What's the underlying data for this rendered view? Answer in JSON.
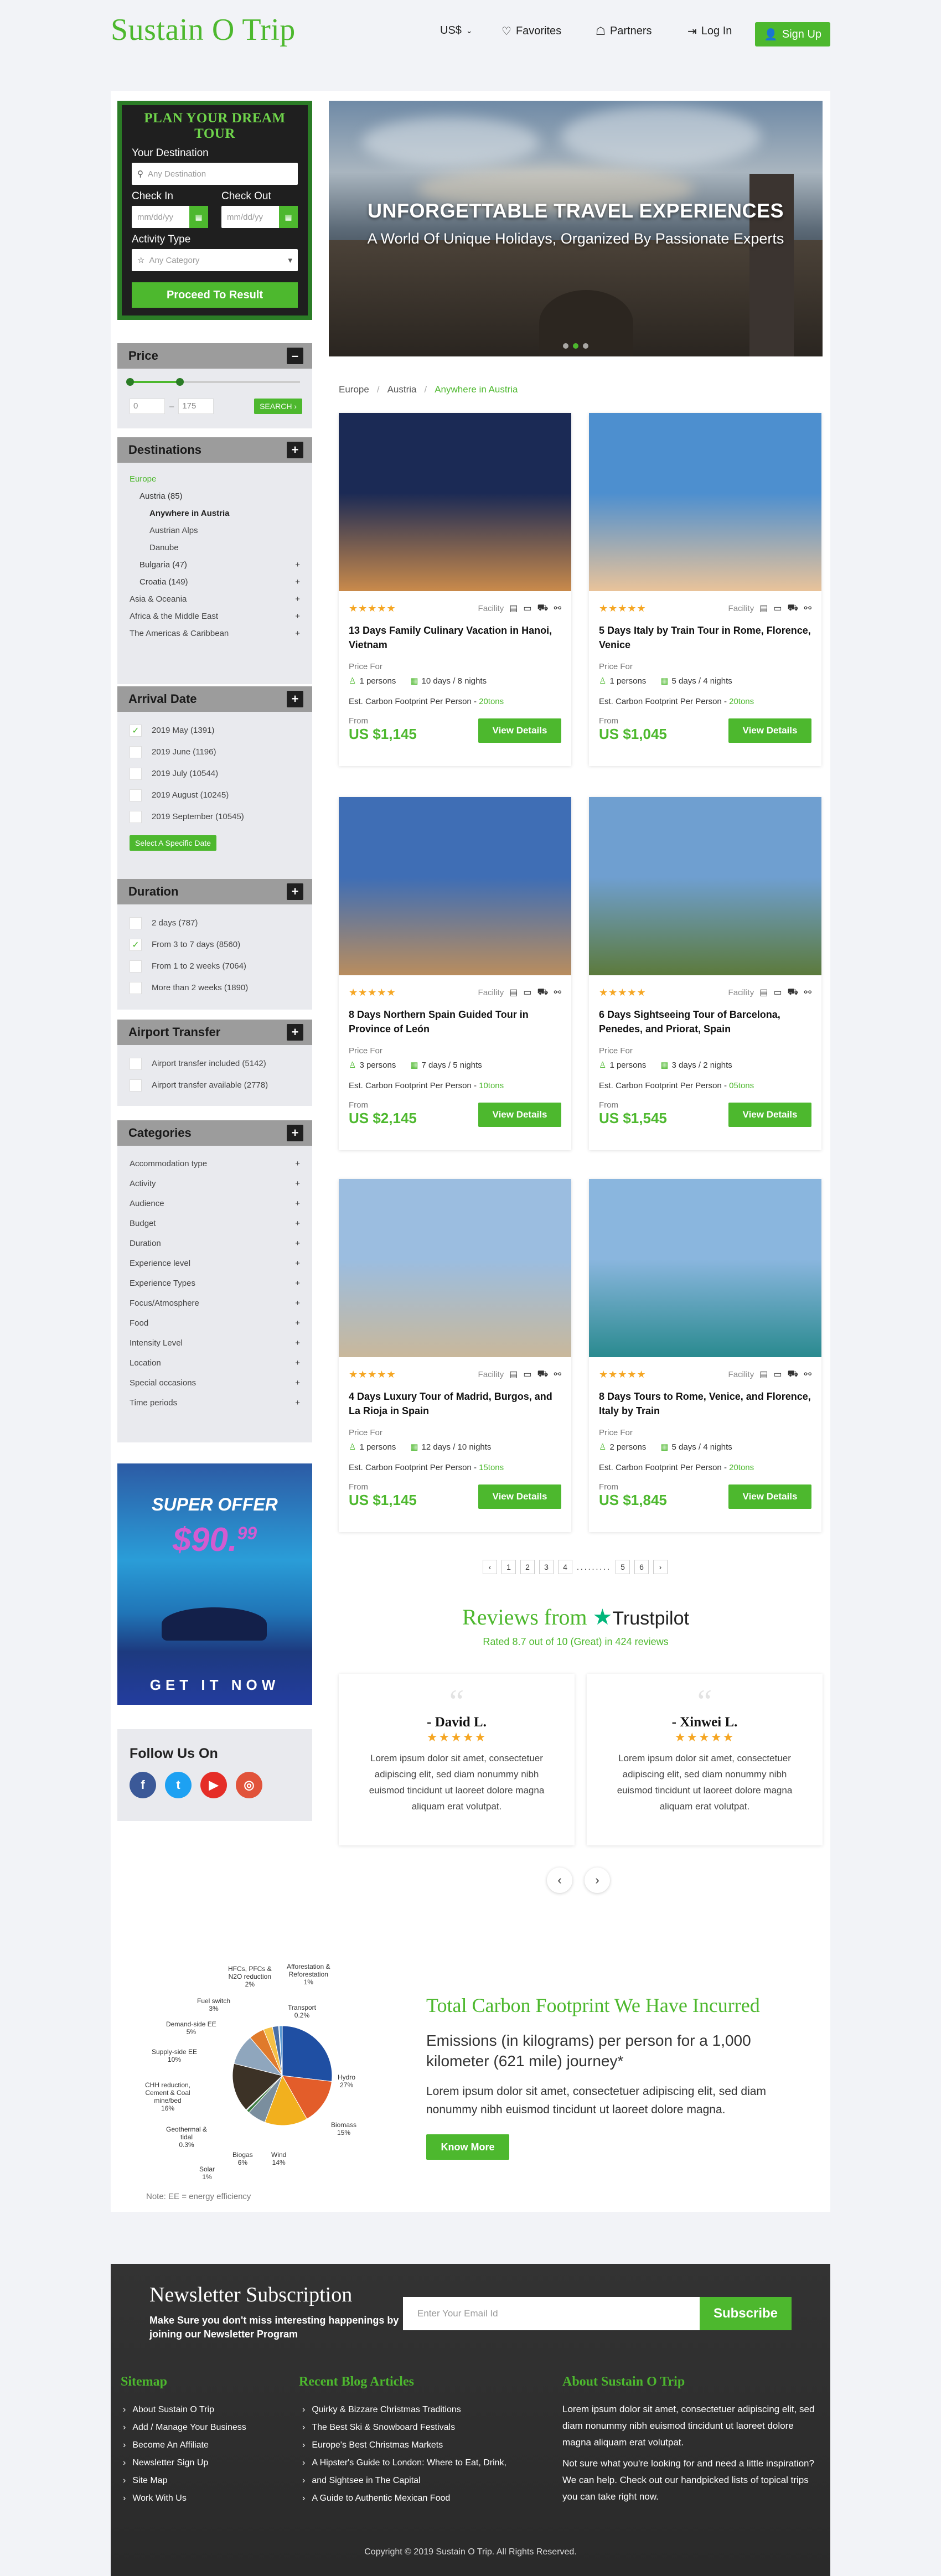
{
  "brand": "Sustain O Trip",
  "nav": {
    "currency": "US$",
    "favorites": "Favorites",
    "partners": "Partners",
    "login": "Log In",
    "signup": "Sign Up"
  },
  "plan": {
    "title": "PLAN YOUR DREAM TOUR",
    "destination_label": "Your Destination",
    "destination_placeholder": "Any Destination",
    "checkin_label": "Check In",
    "checkout_label": "Check Out",
    "date_placeholder": "mm/dd/yy",
    "activity_label": "Activity Type",
    "activity_placeholder": "Any Category",
    "submit": "Proceed To Result"
  },
  "price": {
    "title": "Price",
    "min": "0",
    "sep": "–",
    "max": "175",
    "search": "SEARCH ›"
  },
  "destinations": {
    "title": "Destinations",
    "items": [
      {
        "label": "Europe",
        "level": 0,
        "green": true
      },
      {
        "label": "Austria (85)",
        "level": 1
      },
      {
        "label": "Anywhere in Austria",
        "level": 2,
        "bold": true
      },
      {
        "label": "Austrian Alps",
        "level": 2
      },
      {
        "label": "Danube",
        "level": 2
      },
      {
        "label": "Bulgaria (47)",
        "level": 1,
        "plus": true
      },
      {
        "label": "Croatia (149)",
        "level": 1,
        "plus": true
      },
      {
        "label": "Asia & Oceania",
        "level": 0,
        "plus": true
      },
      {
        "label": "Africa & the Middle East",
        "level": 0,
        "plus": true
      },
      {
        "label": "The Americas & Caribbean",
        "level": 0,
        "plus": true
      }
    ]
  },
  "arrival": {
    "title": "Arrival Date",
    "items": [
      {
        "label": "2019 May (1391)",
        "checked": true
      },
      {
        "label": "2019 June (1196)",
        "checked": false
      },
      {
        "label": "2019 July (10544)",
        "checked": false
      },
      {
        "label": "2019 August (10245)",
        "checked": false
      },
      {
        "label": "2019 September (10545)",
        "checked": false
      }
    ],
    "button": "Select A Specific Date"
  },
  "duration": {
    "title": "Duration",
    "items": [
      {
        "label": "2 days (787)",
        "checked": false
      },
      {
        "label": "From 3 to 7 days (8560)",
        "checked": true
      },
      {
        "label": "From 1 to 2 weeks (7064)",
        "checked": false
      },
      {
        "label": "More than 2 weeks (1890)",
        "checked": false
      }
    ]
  },
  "airport": {
    "title": "Airport Transfer",
    "items": [
      {
        "label": "Airport transfer included (5142)",
        "checked": false
      },
      {
        "label": "Airport transfer available (2778)",
        "checked": false
      }
    ]
  },
  "categories": {
    "title": "Categories",
    "items": [
      "Accommodation type",
      "Activity",
      "Audience",
      "Budget",
      "Duration",
      "Experience level",
      "Experience Types",
      "Focus/Atmosphere",
      "Food",
      "Intensity Level",
      "Location",
      "Special occasions",
      "Time periods"
    ]
  },
  "offer": {
    "title": "SUPER OFFER",
    "price": "$90.",
    "cents": "99",
    "cta": "GET IT NOW"
  },
  "follow": {
    "title": "Follow Us On"
  },
  "hero": {
    "title": "UNFORGETTABLE TRAVEL EXPERIENCES",
    "subtitle": "A World Of Unique Holidays, Organized By Passionate Experts"
  },
  "breadcrumb": [
    "Europe",
    "Austria",
    "Anywhere in Austria"
  ],
  "card_common": {
    "stars": "★★★★★",
    "facility": "Facility",
    "price_for": "Price For",
    "carbon": "Est. Carbon Footprint Per Person -",
    "from": "From",
    "view": "View Details"
  },
  "tours": [
    {
      "title": "13 Days Family Culinary Vacation in Hanoi, Vietnam",
      "persons": "1 persons",
      "duration": "10 days / 8 nights",
      "carbon": "20tons",
      "price": "US $1,145",
      "colors": [
        "#1b2a55",
        "#c98a4b"
      ]
    },
    {
      "title": "5 Days Italy by Train Tour in Rome, Florence, Venice",
      "persons": "1 persons",
      "duration": "5 days / 4 nights",
      "carbon": "20tons",
      "price": "US $1,045",
      "colors": [
        "#4d8fcf",
        "#e9c39a"
      ]
    },
    {
      "title": "8 Days Northern Spain Guided Tour in Province of León",
      "persons": "3 persons",
      "duration": "7 days / 5 nights",
      "carbon": "10tons",
      "price": "US $2,145",
      "colors": [
        "#3f6eb5",
        "#b98d5e"
      ]
    },
    {
      "title": "6 Days Sightseeing Tour of Barcelona, Penedes, and Priorat, Spain",
      "persons": "1 persons",
      "duration": "3 days / 2 nights",
      "carbon": "05tons",
      "price": "US $1,545",
      "colors": [
        "#6f9fd0",
        "#5c7a3c"
      ]
    },
    {
      "title": "4 Days Luxury Tour of Madrid, Burgos, and La Rioja in Spain",
      "persons": "1 persons",
      "duration": "12 days / 10 nights",
      "carbon": "15tons",
      "price": "US $1,145",
      "colors": [
        "#9bbde0",
        "#c9b89b"
      ]
    },
    {
      "title": "8 Days Tours to Rome, Venice, and Florence, Italy by Train",
      "persons": "2 persons",
      "duration": "5 days / 4 nights",
      "carbon": "20tons",
      "price": "US $1,845",
      "colors": [
        "#8ab6de",
        "#2a8a8f"
      ]
    }
  ],
  "pagination": [
    "‹",
    "1",
    "2",
    "3",
    "4",
    ".........",
    "5",
    "6",
    "›"
  ],
  "reviews": {
    "title": "Reviews from",
    "trustpilot": "Trustpilot",
    "subtitle": "Rated 8.7 out of 10 (Great) in 424 reviews",
    "items": [
      {
        "name": "- David L.",
        "text": "Lorem ipsum dolor sit amet, consectetuer adipiscing elit, sed diam nonummy nibh euismod tincidunt ut laoreet dolore magna aliquam erat volutpat."
      },
      {
        "name": "- Xinwei L.",
        "text": "Lorem ipsum dolor sit amet, consectetuer adipiscing elit, sed diam nonummy nibh euismod tincidunt ut laoreet dolore magna aliquam erat volutpat."
      }
    ]
  },
  "chart_data": {
    "type": "pie",
    "title": "",
    "series": [
      {
        "values": [
          27,
          15,
          14,
          6,
          1,
          0.3,
          16,
          10,
          5,
          3,
          2,
          0.2,
          1
        ]
      }
    ],
    "categories": [
      "Hydro",
      "Biomass",
      "Wind",
      "Biogas",
      "Solar",
      "Geothermal & tidal",
      "CHH reduction, Cement & Coal mine/bed",
      "Supply-side EE",
      "Demand-side EE",
      "Fuel switch",
      "HFCs, PFCs & N2O reduction",
      "Transport",
      "Afforestation & Reforestation"
    ],
    "labels": [
      "Hydro\n27%",
      "Biomass\n15%",
      "Wind\n14%",
      "Biogas\n6%",
      "Solar\n1%",
      "Geothermal &\ntidal\n0.3%",
      "CHH reduction,\nCement & Coal\nmine/bed\n16%",
      "Supply-side EE\n10%",
      "Demand-side EE\n5%",
      "Fuel switch\n3%",
      "HFCs, PFCs &\nN2O reduction\n2%",
      "Transport\n0.2%",
      "Afforestation &\nReforestation\n1%"
    ],
    "colors": [
      "#1f4fa3",
      "#e35d2a",
      "#f2b01e",
      "#7a8e9e",
      "#3a7d3f",
      "#9fb3c8",
      "#3c3226",
      "#8fa6bd",
      "#e07a2b",
      "#f5c046",
      "#4a6fa5",
      "#c9d3dd",
      "#5b9bd5"
    ],
    "note": "Note: EE = energy efficiency"
  },
  "carbon": {
    "title": "Total Carbon Footprint We Have Incurred",
    "sub": "Emissions (in kilograms) per person for a 1,000 kilometer (621 mile) journey*",
    "text": "Lorem ipsum dolor sit amet, consectetuer adipiscing elit, sed diam nonummy nibh euismod tincidunt ut laoreet dolore magna.",
    "button": "Know More"
  },
  "newsletter": {
    "title": "Newsletter Subscription",
    "sub": "Make Sure you don't miss interesting happenings by joining our Newsletter Program",
    "placeholder": "Enter Your Email Id",
    "button": "Subscribe"
  },
  "footer": {
    "sitemap_title": "Sitemap",
    "sitemap": [
      "About Sustain O Trip",
      "Add / Manage Your Business",
      "Become An Affiliate",
      "Newsletter Sign Up",
      "Site Map",
      "Work With Us"
    ],
    "blog_title": "Recent Blog Articles",
    "blog": [
      "Quirky & Bizzare Christmas Traditions",
      "The Best Ski & Snowboard Festivals",
      "Europe's Best Christmas Markets",
      "A Hipster's Guide to London: Where to Eat, Drink,",
      "and Sightsee in The Capital",
      "A Guide to Authentic Mexican Food"
    ],
    "about_title": "About Sustain O Trip",
    "about1": "Lorem ipsum dolor sit amet, consectetuer adipiscing elit, sed diam nonummy nibh euismod tincidunt ut laoreet dolore magna aliquam erat volutpat.",
    "about2": "Not sure what you're looking for and need a little inspiration? We can help. Check out our handpicked lists of topical trips you can take right now.",
    "copyright": "Copyright © 2019 Sustain O Trip. All Rights Reserved."
  }
}
